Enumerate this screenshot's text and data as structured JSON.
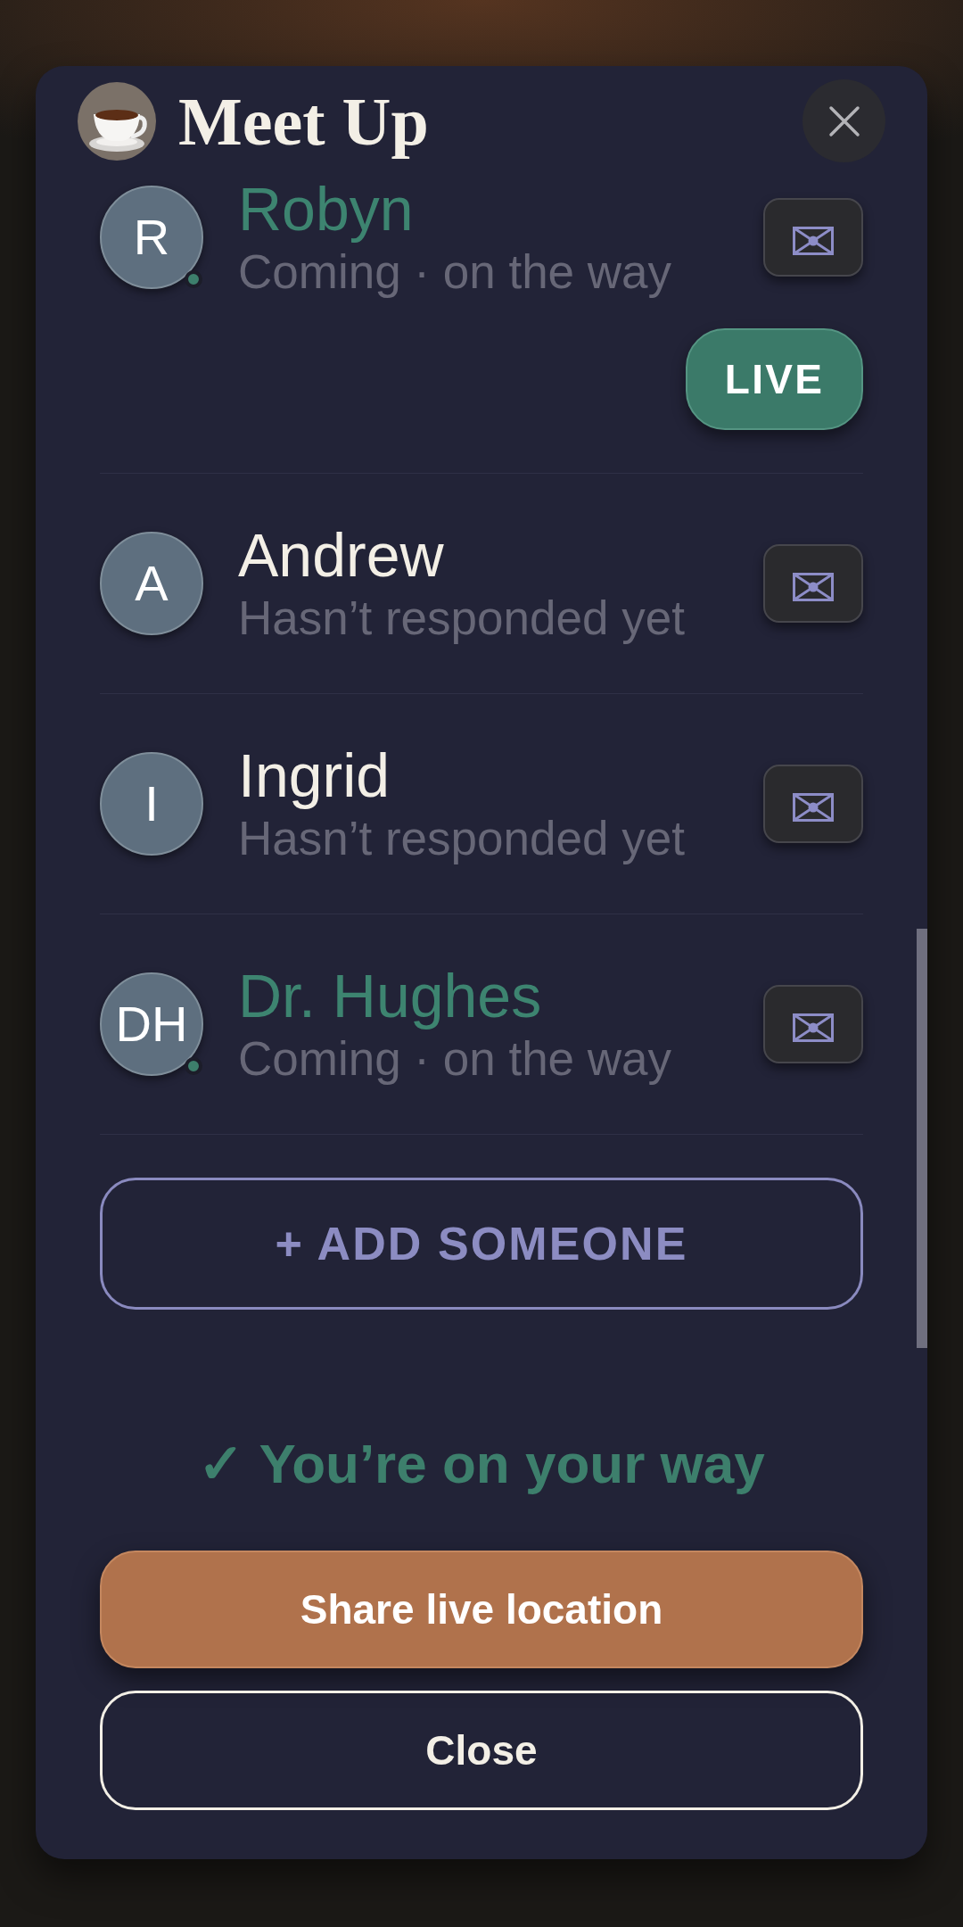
{
  "header": {
    "title": "Meet Up"
  },
  "members": [
    {
      "initials": "R",
      "name": "Robyn",
      "status": "Coming · on the way",
      "coming": true,
      "badge": "LIVE"
    },
    {
      "initials": "A",
      "name": "Andrew",
      "status": "Hasn’t responded yet",
      "coming": false
    },
    {
      "initials": "I",
      "name": "Ingrid",
      "status": "Hasn’t responded yet",
      "coming": false
    },
    {
      "initials": "DH",
      "name": "Dr. Hughes",
      "status": "Coming · on the way",
      "coming": true
    }
  ],
  "add_button": {
    "label": "+ ADD SOMEONE"
  },
  "status_message": "✓ You’re on your way",
  "buttons": [
    {
      "label": "Share live location",
      "kind": "primary"
    },
    {
      "label": "Close",
      "kind": "outline"
    }
  ]
}
